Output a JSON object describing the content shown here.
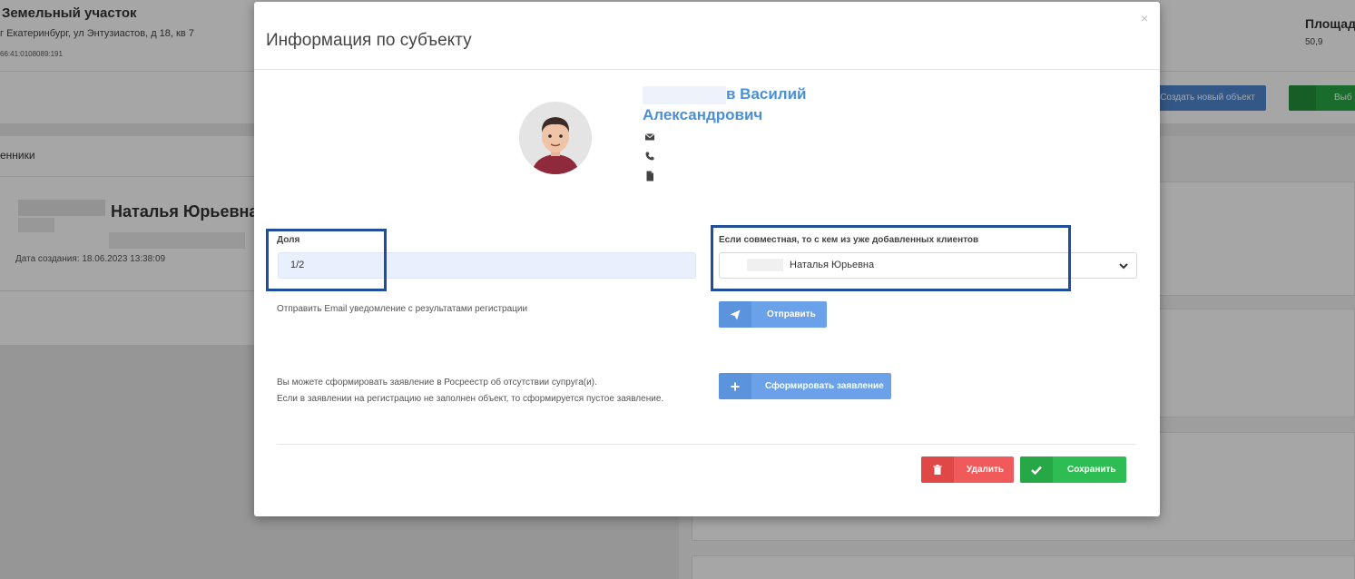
{
  "background": {
    "object_title": "Земельный участок",
    "address": "г Екатеринбург, ул Энтузиастов, д 18, кв 7",
    "cadastral": "66:41:0108089:191",
    "area_header": "Площад",
    "area_value": "50,9",
    "create_object_button": "Создать новый объект",
    "green_button": "Выб",
    "members_header": "енники",
    "member_name": "Наталья Юрьевна",
    "created_date": "Дата создания: 18.06.2023 13:38:09"
  },
  "modal": {
    "title": "Информация по субъекту",
    "close_glyph": "×",
    "person": {
      "name_line1_suffix": "в Василий",
      "name_line2": "Александрович"
    },
    "share": {
      "label": "Доля",
      "value": "1/2"
    },
    "joint": {
      "label": "Если совместная, то с кем из уже добавленных клиентов",
      "selected": "Наталья Юрьевна"
    },
    "email_notice": "Отправить Email уведомление с результатами регистрации",
    "send_button": "Отправить",
    "statement_line1": "Вы можете сформировать заявление в Росреестр об отсутствии супруга(и).",
    "statement_line2": "Если в заявлении на регистрацию не заполнен объект, то сформируется пустое заявление.",
    "form_button": "Сформировать заявление",
    "delete_button": "Удалить",
    "save_button": "Сохранить"
  },
  "colors": {
    "accent_blue": "#4a90d9",
    "highlight_box": "#1f4e9a",
    "delete_red": "#f05a5a",
    "save_green": "#2ebd52"
  },
  "icons": [
    "envelope-icon",
    "phone-icon",
    "file-icon",
    "paper-plane-icon",
    "plus-icon",
    "trash-icon",
    "check-icon",
    "chevron-down-icon"
  ]
}
